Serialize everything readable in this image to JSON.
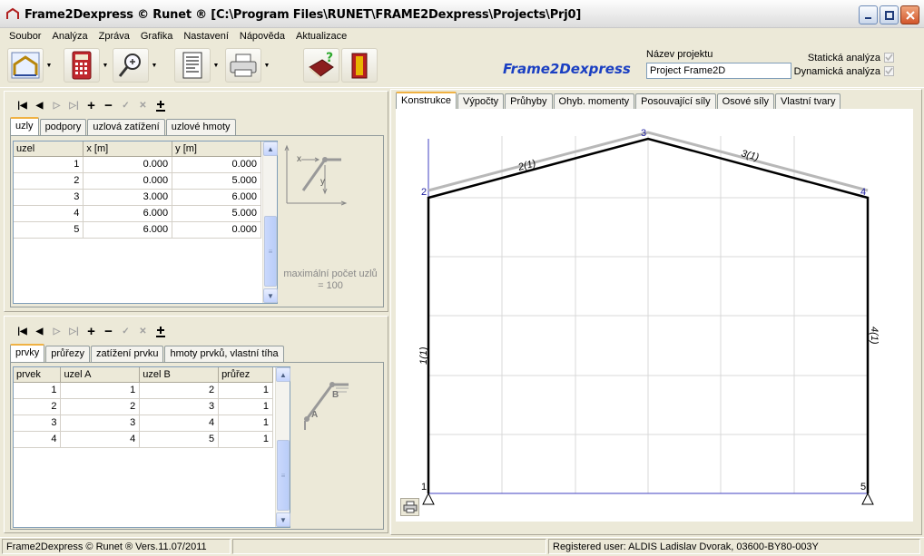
{
  "window": {
    "title": "Frame2Dexpress © Runet ® [C:\\Program Files\\RUNET\\FRAME2Dexpress\\Projects\\Prj0]",
    "minimize_icon": "minimize-icon",
    "maximize_icon": "maximize-icon",
    "close_icon": "close-icon"
  },
  "menu": [
    "Soubor",
    "Analýza",
    "Zpráva",
    "Grafika",
    "Nastavení",
    "Nápověda",
    "Aktualizace"
  ],
  "toolbar": {
    "icons": [
      "frame-model-icon",
      "calculator-icon",
      "magnifier-icon",
      "report-icon",
      "printer-icon",
      "help-book-icon",
      "manual-book-icon"
    ],
    "brand": "Frame2Dexpress",
    "project_label": "Název projektu",
    "project_value": "Project Frame2D",
    "static_label": "Statická analýza",
    "dynamic_label": "Dynamická analýza"
  },
  "nodes_panel": {
    "tabs": [
      "uzly",
      "podpory",
      "uzlová zatížení",
      "uzlové hmoty"
    ],
    "columns": [
      "uzel",
      "x [m]",
      "y [m]"
    ],
    "rows": [
      [
        "1",
        "0.000",
        "0.000"
      ],
      [
        "2",
        "0.000",
        "5.000"
      ],
      [
        "3",
        "3.000",
        "6.000"
      ],
      [
        "4",
        "6.000",
        "5.000"
      ],
      [
        "5",
        "6.000",
        "0.000"
      ]
    ],
    "diagram_x": "x",
    "diagram_y": "y",
    "max_note": "maximální počet uzlů = 100"
  },
  "elements_panel": {
    "tabs": [
      "prvky",
      "průřezy",
      "zatížení prvku",
      "hmoty prvků, vlastní tíha"
    ],
    "columns": [
      "prvek",
      "uzel A",
      "uzel B",
      "průřez"
    ],
    "rows": [
      [
        "1",
        "1",
        "2",
        "1"
      ],
      [
        "2",
        "2",
        "3",
        "1"
      ],
      [
        "3",
        "3",
        "4",
        "1"
      ],
      [
        "4",
        "4",
        "5",
        "1"
      ]
    ],
    "diagram_a": "A",
    "diagram_b": "B"
  },
  "right_tabs": [
    "Konstrukce",
    "Výpočty",
    "Průhyby",
    "Ohyb. momenty",
    "Posouvající síly",
    "Osové síly",
    "Vlastní tvary"
  ],
  "model": {
    "node_labels": [
      "1",
      "2",
      "3",
      "4",
      "5"
    ],
    "element_labels": [
      "1(1)",
      "2(1)",
      "3(1)",
      "4(1)"
    ]
  },
  "status": {
    "left": "Frame2Dexpress © Runet ®  Vers.11.07/2011",
    "right": "Registered user: ALDIS Ladislav Dvorak, 03600-BY80-003Y"
  }
}
